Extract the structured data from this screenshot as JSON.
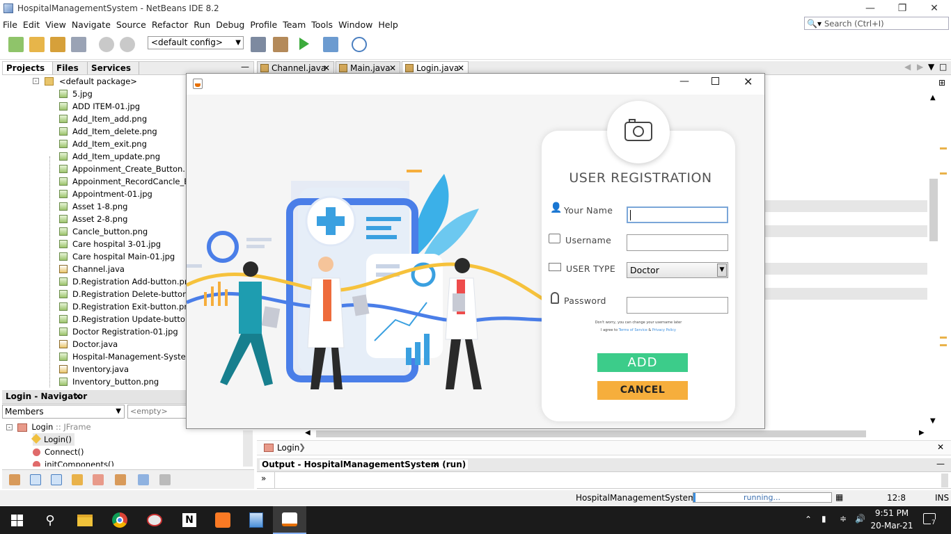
{
  "window": {
    "title": "HospitalManagementSystem - NetBeans IDE 8.2"
  },
  "menu": [
    "File",
    "Edit",
    "View",
    "Navigate",
    "Source",
    "Refactor",
    "Run",
    "Debug",
    "Profile",
    "Team",
    "Tools",
    "Window",
    "Help"
  ],
  "search": {
    "placeholder": "Search (Ctrl+I)"
  },
  "toolbar": {
    "config": "<default config>"
  },
  "project_tabs": [
    "Projects",
    "Files",
    "Services"
  ],
  "tree": {
    "package": "<default package>",
    "files": [
      "5.jpg",
      "ADD ITEM-01.jpg",
      "Add_Item_add.png",
      "Add_Item_delete.png",
      "Add_Item_exit.png",
      "Add_Item_update.png",
      "Appoinment_Create_Button.png",
      "Appoinment_RecordCancle_Back B",
      "Appointment-01.jpg",
      "Asset 1-8.png",
      "Asset 2-8.png",
      "Cancle_button.png",
      "Care hospital 3-01.jpg",
      "Care hospital Main-01.jpg",
      "Channel.java",
      "D.Registration Add-button.png",
      "D.Registration Delete-button.png",
      "D.Registration Exit-button.png",
      "D.Registration Update-button.png",
      "Doctor Registration-01.jpg",
      "Doctor.java",
      "Hospital-Management-System.png",
      "Inventory.java",
      "Inventory_button.png"
    ]
  },
  "navigator": {
    "title": "Login - Navigator",
    "members": "Members",
    "filter": "<empty>",
    "root": "Login",
    "root_type": ":: JFrame",
    "items": [
      "Login()",
      "Connect()",
      "initComponents()"
    ]
  },
  "editor_tabs": [
    "Channel.java",
    "Main.java",
    "Login.java"
  ],
  "breadcrumb": "Login",
  "output": {
    "title": "Output - HospitalManagementSystem (run)",
    "prompt": "»"
  },
  "status": {
    "project": "HospitalManagementSystem (run)",
    "progress": "running...",
    "position": "12:8",
    "mode": "INS"
  },
  "taskbar": {
    "time": "9:51 PM",
    "date": "20-Mar-21",
    "notifications": "7"
  },
  "dialog": {
    "heading": "USER REGISTRATION",
    "fields": {
      "name_label": "Your Name",
      "username_label": "Username",
      "usertype_label": "USER TYPE",
      "password_label": "Password",
      "usertype_value": "Doctor"
    },
    "note1": "Don't worry, you can change your username later",
    "note2_prefix": "I agree to",
    "terms": "Terms of Service",
    "amp": "&",
    "privacy": "Privacy Policy",
    "add": "ADD",
    "cancel": "CANCEL"
  },
  "colors": {
    "add": "#3ccc8a",
    "cancel": "#f6ae3c",
    "accent": "#3b8fe0"
  }
}
